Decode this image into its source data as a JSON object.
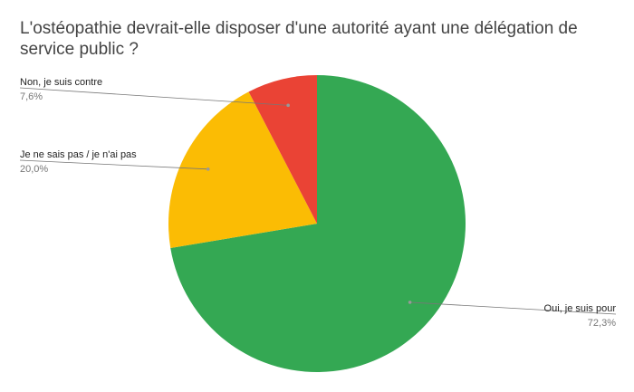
{
  "chart_data": {
    "type": "pie",
    "title": "L'ostéopathie devrait-elle disposer d'une autorité ayant une délégation de service public ?",
    "slices": [
      {
        "label": "Oui, je suis pour",
        "value": 72.3,
        "value_label": "72,3%",
        "color": "#34a853"
      },
      {
        "label": "Je ne sais pas / je n'ai pas",
        "value": 20.0,
        "value_label": "20,0%",
        "color": "#fbbc04"
      },
      {
        "label": "Non, je suis contre",
        "value": 7.6,
        "value_label": "7,6%",
        "color": "#ea4335"
      }
    ]
  }
}
